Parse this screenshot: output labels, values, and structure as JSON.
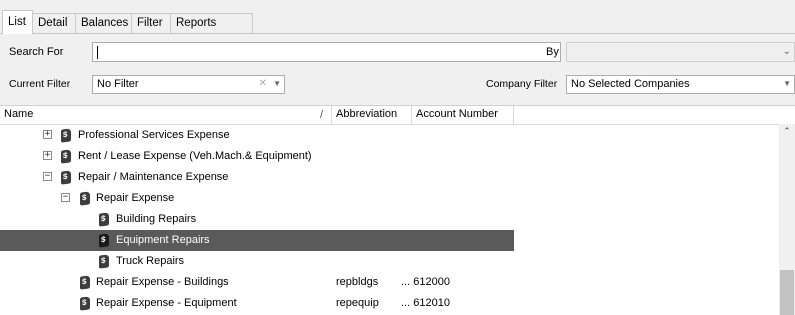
{
  "tabs": [
    "List",
    "Detail",
    "Balances",
    "Filter",
    "Reports"
  ],
  "search": {
    "label": "Search For",
    "value": ""
  },
  "by": {
    "label": "By",
    "value": ""
  },
  "current_filter": {
    "label": "Current Filter",
    "value": "No Filter"
  },
  "company_filter": {
    "label": "Company Filter",
    "value": "No Selected Companies"
  },
  "columns": {
    "name": "Name",
    "sort_glyph": "/",
    "abbreviation": "Abbreviation",
    "account_number": "Account Number"
  },
  "rows": [
    {
      "name": "Professional Services Expense",
      "abbreviation": "",
      "account_number": "",
      "expander": "+"
    },
    {
      "name": "Rent / Lease Expense (Veh.Mach.& Equipment)",
      "abbreviation": "",
      "account_number": "",
      "expander": "+"
    },
    {
      "name": "Repair / Maintenance Expense",
      "abbreviation": "",
      "account_number": "",
      "expander": "−"
    },
    {
      "name": "Repair Expense",
      "abbreviation": "",
      "account_number": "",
      "expander": "−"
    },
    {
      "name": "Building Repairs",
      "abbreviation": "",
      "account_number": "",
      "expander": ""
    },
    {
      "name": "Equipment Repairs",
      "abbreviation": "",
      "account_number": "",
      "expander": "",
      "selected": true
    },
    {
      "name": "Truck Repairs",
      "abbreviation": "",
      "account_number": "",
      "expander": ""
    },
    {
      "name": "Repair Expense - Buildings",
      "abbreviation": "repbldgs",
      "account_number": "... 612000",
      "expander": ""
    },
    {
      "name": "Repair Expense - Equipment",
      "abbreviation": "repequip",
      "account_number": "... 612010",
      "expander": ""
    }
  ],
  "colors": {
    "selected_row": "#5a5a5a",
    "icon": "#3d3d3d"
  }
}
